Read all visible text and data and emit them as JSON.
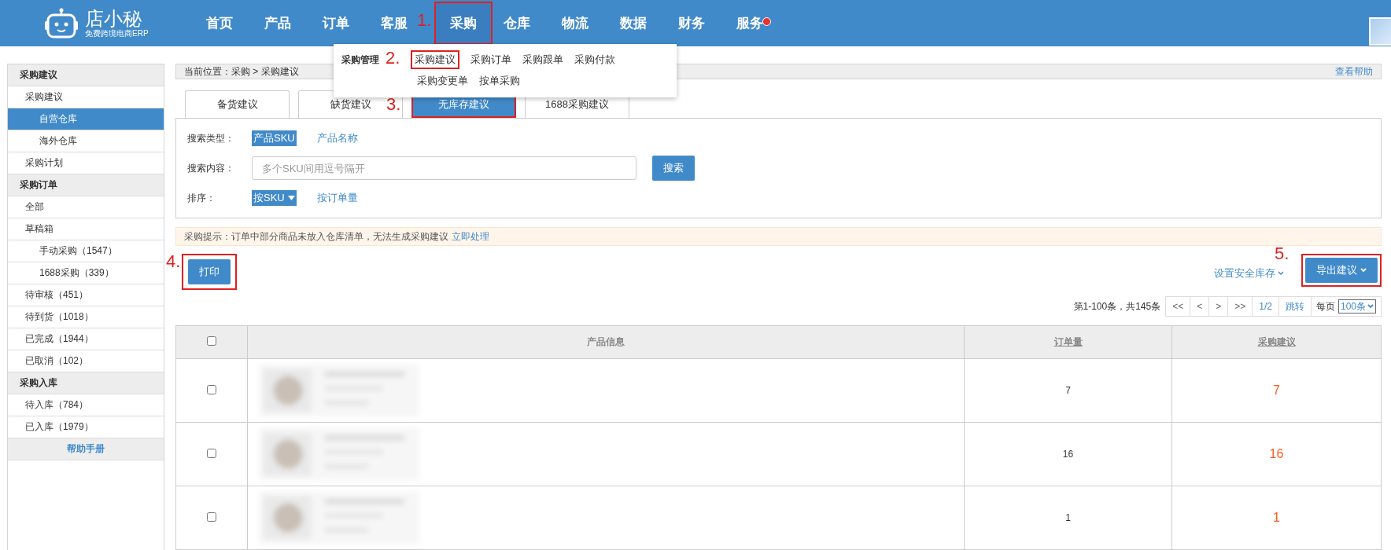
{
  "header": {
    "logo": {
      "name": "店小秘",
      "tagline": "免费跨境电商ERP"
    },
    "nav": [
      {
        "label": "首页",
        "selected": false,
        "notification": false
      },
      {
        "label": "产品",
        "selected": false,
        "notification": false
      },
      {
        "label": "订单",
        "selected": false,
        "notification": false
      },
      {
        "label": "客服",
        "selected": false,
        "notification": false
      },
      {
        "label": "采购",
        "selected": true,
        "notification": false,
        "callout": "1."
      },
      {
        "label": "仓库",
        "selected": false,
        "notification": false
      },
      {
        "label": "物流",
        "selected": false,
        "notification": false
      },
      {
        "label": "数据",
        "selected": false,
        "notification": false
      },
      {
        "label": "财务",
        "selected": false,
        "notification": false
      },
      {
        "label": "服务",
        "selected": false,
        "notification": true
      }
    ]
  },
  "menu": {
    "group": "采购管理",
    "rows": [
      [
        {
          "label": "采购建议",
          "callout": "2."
        },
        {
          "label": "采购订单"
        },
        {
          "label": "采购跟单"
        },
        {
          "label": "采购付款"
        }
      ],
      [
        {
          "label": "采购变更单"
        },
        {
          "label": "按单采购"
        }
      ]
    ]
  },
  "sidebar": {
    "sections": [
      {
        "title": "采购建议",
        "items": [
          {
            "label": "采购建议",
            "selected": false,
            "children": [
              {
                "label": "自营仓库",
                "selected": true
              },
              {
                "label": "海外仓库",
                "selected": false
              }
            ]
          },
          {
            "label": "采购计划",
            "selected": false
          }
        ]
      },
      {
        "title": "采购订单",
        "items": [
          {
            "label": "全部",
            "selected": false
          },
          {
            "label": "草稿箱",
            "selected": false,
            "children": [
              {
                "label": "手动采购（1547）",
                "selected": false
              },
              {
                "label": "1688采购（339）",
                "selected": false
              }
            ]
          },
          {
            "label": "待审核（451）",
            "selected": false
          },
          {
            "label": "待到货（1018）",
            "selected": false
          },
          {
            "label": "已完成（1944）",
            "selected": false
          },
          {
            "label": "已取消（102）",
            "selected": false
          }
        ]
      },
      {
        "title": "采购入库",
        "items": [
          {
            "label": "待入库（784）",
            "selected": false
          },
          {
            "label": "已入库（1979）",
            "selected": false
          }
        ]
      }
    ],
    "footer": "帮助手册"
  },
  "breadcrumb": {
    "text": "当前位置：采购 > 采购建议",
    "help": "查看帮助"
  },
  "tabs": [
    {
      "label": "备货建议",
      "selected": false
    },
    {
      "label": "缺货建议",
      "selected": false
    },
    {
      "label": "无库存建议",
      "selected": true,
      "callout": "3."
    },
    {
      "label": "1688采购建议",
      "selected": false
    }
  ],
  "search": {
    "type_label": "搜索类型：",
    "types": [
      {
        "label": "产品SKU",
        "selected": true
      },
      {
        "label": "产品名称",
        "selected": false
      }
    ],
    "content_label": "搜索内容：",
    "placeholder": "多个SKU间用逗号隔开",
    "button": "搜索",
    "sort_label": "排序：",
    "sorts": [
      {
        "label": "按SKU",
        "selected": true
      },
      {
        "label": "按订单量",
        "selected": false
      }
    ]
  },
  "notice": {
    "text": "采购提示：订单中部分商品未放入仓库清单，无法生成采购建议",
    "link": "立即处理"
  },
  "actions": {
    "print": {
      "label": "打印",
      "callout": "4."
    },
    "safety_stock": "设置安全库存",
    "export": {
      "label": "导出建议",
      "callout": "5."
    }
  },
  "pagination": {
    "summary": "第1-100条，共145条",
    "buttons": [
      {
        "label": "<<",
        "kind": "nav"
      },
      {
        "label": "<",
        "kind": "nav"
      },
      {
        "label": ">",
        "kind": "nav"
      },
      {
        "label": ">>",
        "kind": "nav"
      },
      {
        "label": "1/2",
        "kind": "page"
      },
      {
        "label": "跳转",
        "kind": "page"
      }
    ],
    "per_page_label": "每页",
    "per_page": "100条"
  },
  "table": {
    "header_checked": false,
    "columns": [
      {
        "label": "产品信息",
        "sortable": false
      },
      {
        "label": "订单量",
        "sortable": true
      },
      {
        "label": "采购建议",
        "sortable": true
      }
    ],
    "rows": [
      {
        "checked": false,
        "order_qty": "7",
        "suggestion": "7"
      },
      {
        "checked": false,
        "order_qty": "16",
        "suggestion": "16"
      },
      {
        "checked": false,
        "order_qty": "1",
        "suggestion": "1"
      }
    ]
  }
}
